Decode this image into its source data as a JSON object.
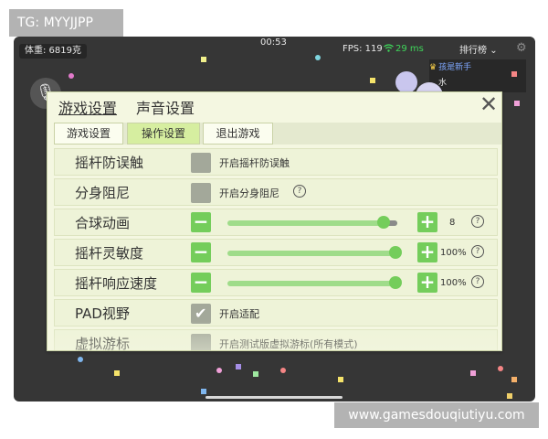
{
  "watermarks": {
    "top": "TG: MYYJJPP",
    "bottom": "www.gamesdouqiutiyu.com"
  },
  "hud": {
    "weight": "体重: 6819克",
    "time": "00:53",
    "fps": "FPS: 119",
    "wifi_icon": "wifi-icon",
    "ping": "29 ms",
    "leaderboard": "排行榜",
    "leaderboard_rows": [
      "孩是新手",
      "水"
    ]
  },
  "colors": {
    "accent_green": "#74cd5b",
    "dialog_bg": "#f4f7e1",
    "ping_green": "#3fd65a"
  },
  "dialog": {
    "tabs": [
      {
        "label": "游戏设置",
        "active": true
      },
      {
        "label": "声音设置",
        "active": false
      }
    ],
    "close_label": "✕",
    "subtabs": [
      {
        "label": "游戏设置",
        "active": false
      },
      {
        "label": "操作设置",
        "active": true
      },
      {
        "label": "退出游戏",
        "active": false
      }
    ],
    "rows": [
      {
        "label": "摇杆防误触",
        "type": "checkbox",
        "checked": false,
        "option": "开启摇杆防误触"
      },
      {
        "label": "分身阻尼",
        "type": "checkbox",
        "checked": false,
        "option": "开启分身阻尼",
        "help": "?"
      },
      {
        "label": "合球动画",
        "type": "slider",
        "fraction": 0.92,
        "value": "8",
        "help": "?"
      },
      {
        "label": "摇杆灵敏度",
        "type": "slider",
        "fraction": 1.0,
        "value": "100%",
        "help": "?"
      },
      {
        "label": "摇杆响应速度",
        "type": "slider",
        "fraction": 1.0,
        "value": "100%",
        "help": "?"
      },
      {
        "label": "PAD视野",
        "type": "checkbox",
        "checked": true,
        "option": "开启适配"
      },
      {
        "label": "虚拟游标",
        "type": "checkbox",
        "checked": false,
        "option": "开启测试版虚拟游标(所有模式)"
      }
    ],
    "minus_label": "−",
    "plus_label": "+"
  }
}
